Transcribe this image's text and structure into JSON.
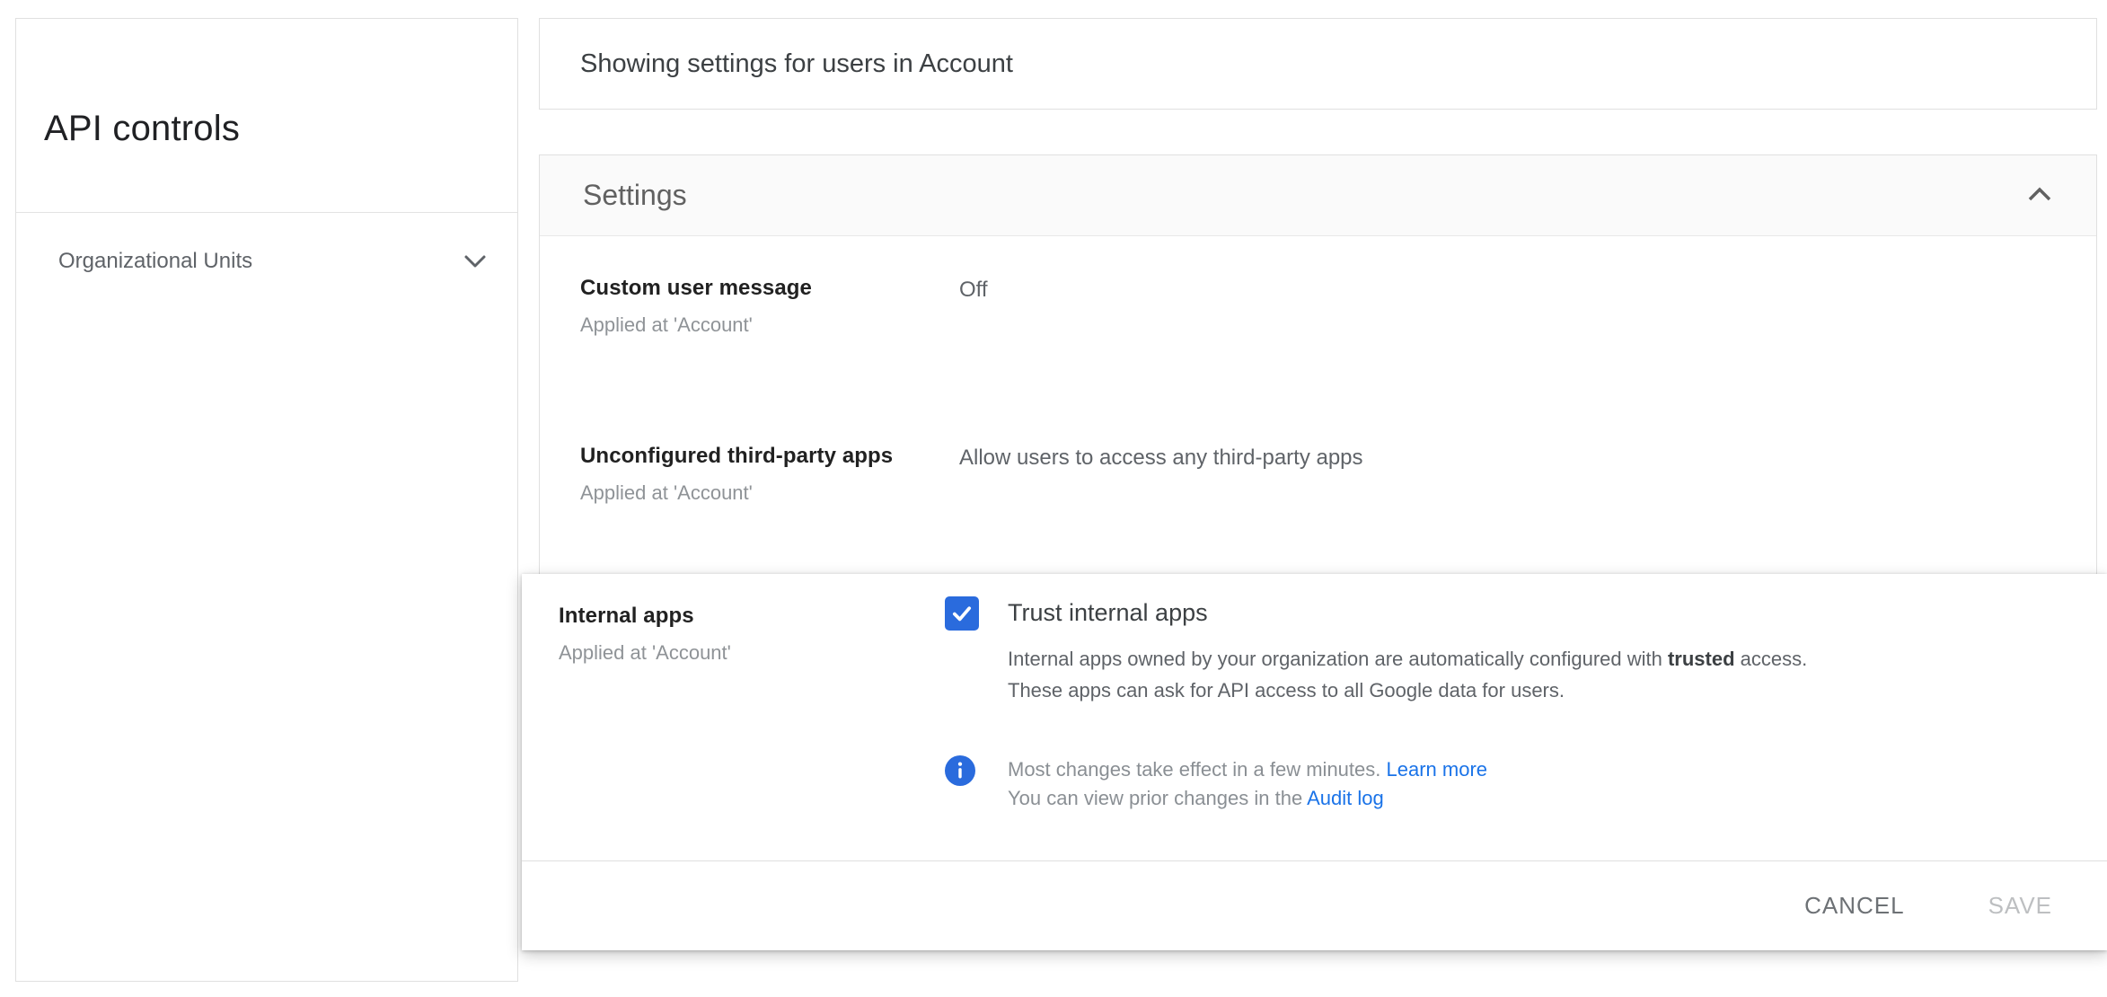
{
  "sidebar": {
    "title": "API controls",
    "org_units_label": "Organizational Units"
  },
  "scope_header": {
    "text": "Showing settings for users in Account"
  },
  "settings": {
    "section_title": "Settings",
    "rows": [
      {
        "label": "Custom user message",
        "applied_at": "Applied at 'Account'",
        "value": "Off"
      },
      {
        "label": "Unconfigured third-party apps",
        "applied_at": "Applied at 'Account'",
        "value": "Allow users to access any third-party apps"
      }
    ]
  },
  "internal_apps": {
    "label": "Internal apps",
    "applied_at": "Applied at 'Account'",
    "checkbox_checked": true,
    "checkbox_label": "Trust internal apps",
    "desc_before": "Internal apps owned by your organization are automatically configured with ",
    "desc_bold": "trusted",
    "desc_after": " access.",
    "desc_line2": "These apps can ask for API access to all Google data for users.",
    "info_line1": "Most changes take effect in a few minutes.",
    "info_link1": "Learn more",
    "info_line2": "You can view prior changes in the",
    "info_link2": "Audit log",
    "cancel_label": "CANCEL",
    "save_label": "SAVE",
    "save_enabled": false
  },
  "colors": {
    "checkbox_blue": "#2a6bdd",
    "info_blue": "#2a6bdd",
    "link_blue": "#1a73e8",
    "section_header_bg": "#fafafa",
    "card_border": "#e0e0e0"
  }
}
